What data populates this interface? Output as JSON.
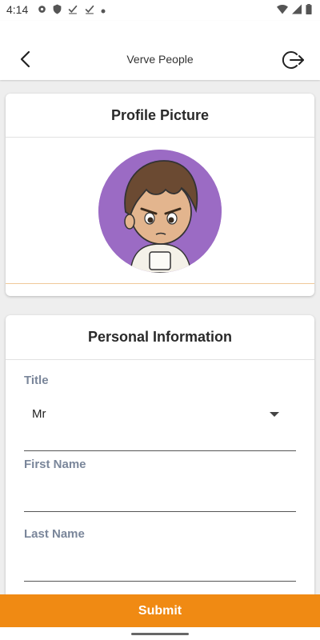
{
  "status_bar": {
    "time": "4:14"
  },
  "app_bar": {
    "title": "Verve People"
  },
  "profile_card": {
    "title": "Profile Picture"
  },
  "personal_card": {
    "title": "Personal Information",
    "fields": {
      "title": {
        "label": "Title",
        "value": "Mr"
      },
      "first_name": {
        "label": "First Name",
        "value": ""
      },
      "last_name": {
        "label": "Last Name",
        "value": ""
      }
    }
  },
  "submit": {
    "label": "Submit"
  },
  "colors": {
    "accent": "#f08a13",
    "avatar_bg": "#9b6bc4",
    "label": "#7a869a"
  }
}
